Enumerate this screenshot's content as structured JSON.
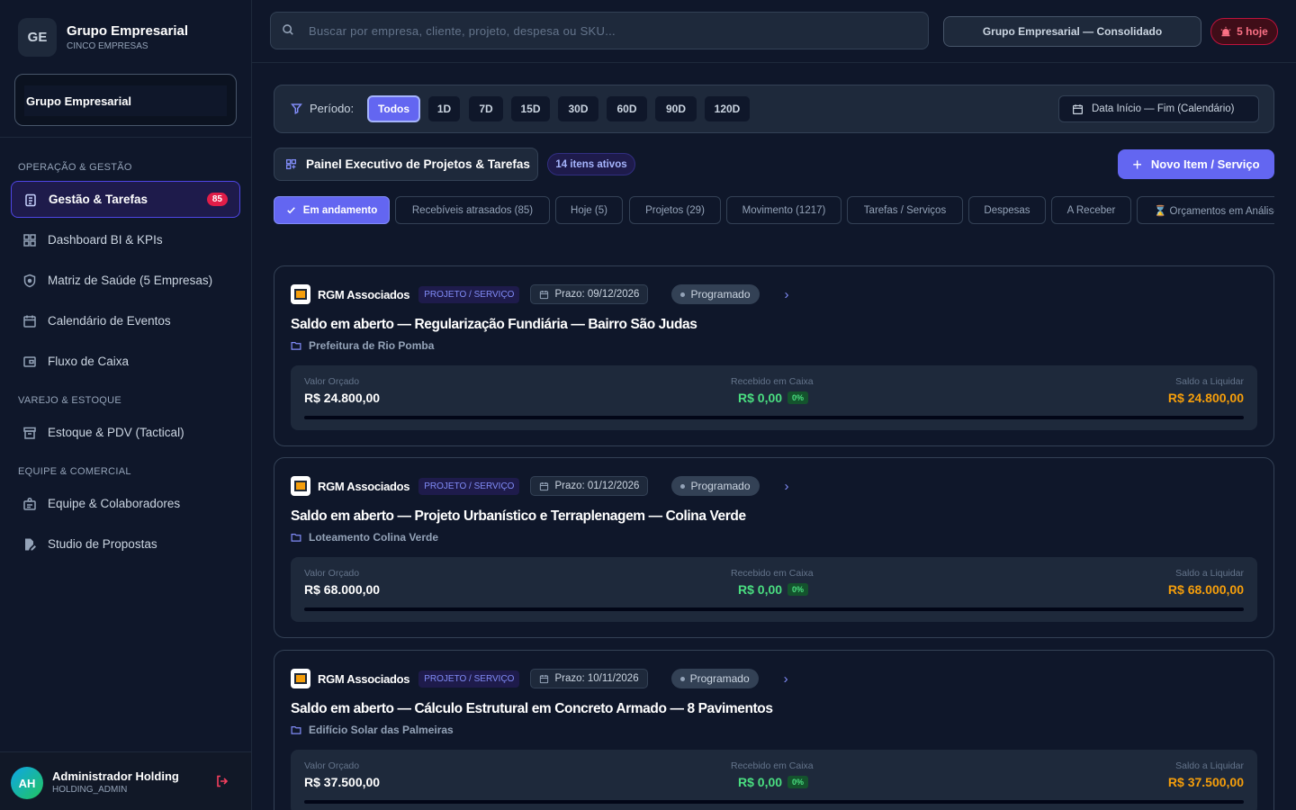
{
  "brand": {
    "initials": "GE",
    "title": "Grupo Empresarial",
    "subtitle": "CINCO EMPRESAS"
  },
  "company_selector": {
    "value": "Grupo Empresarial"
  },
  "sidebar": {
    "sections": [
      {
        "label": "OPERAÇÃO & GESTÃO"
      },
      {
        "label": "VAREJO & ESTOQUE"
      },
      {
        "label": "EQUIPE & COMERCIAL"
      }
    ],
    "items": [
      {
        "label": "Gestão & Tarefas",
        "icon": "clipboard-icon",
        "badge": "85"
      },
      {
        "label": "Dashboard BI & KPIs",
        "icon": "dashboard-icon"
      },
      {
        "label": "Matriz de Saúde (5 Empresas)",
        "icon": "shield-icon"
      },
      {
        "label": "Calendário de Eventos",
        "icon": "calendar-icon"
      },
      {
        "label": "Fluxo de Caixa",
        "icon": "wallet-icon"
      },
      {
        "label": "Estoque & PDV (Tactical)",
        "icon": "box-icon"
      },
      {
        "label": "Equipe & Colaboradores",
        "icon": "team-icon"
      },
      {
        "label": "Studio de Propostas",
        "icon": "file-edit-icon"
      }
    ]
  },
  "user": {
    "initials": "AH",
    "name": "Administrador Holding",
    "role": "HOLDING_ADMIN"
  },
  "topbar": {
    "search_placeholder": "Buscar por empresa, cliente, projeto, despesa ou SKU...",
    "scope": "Grupo Empresarial — Consolidado",
    "alerts": "5 hoje"
  },
  "filter": {
    "label": "Período:",
    "periods": [
      "Todos",
      "1D",
      "7D",
      "15D",
      "30D",
      "60D",
      "90D",
      "120D"
    ],
    "active_period": "Todos",
    "date_range": "Data Início — Fim (Calendário)"
  },
  "panel": {
    "title": "Painel Executivo de Projetos & Tarefas",
    "count": "14 itens ativos",
    "new_button": "Novo Item / Serviço"
  },
  "tabs": [
    "Em andamento",
    "Recebíveis atrasados (85)",
    "Hoje (5)",
    "Projetos (29)",
    "Movimento (1217)",
    "Tarefas / Serviços",
    "Despesas",
    "A Receber",
    "⌛ Orçamentos em Análise"
  ],
  "fin_labels": {
    "budget": "Valor Orçado",
    "received": "Recebido em Caixa",
    "balance": "Saldo a Liquidar"
  },
  "cards": [
    {
      "client": "RGM Associados",
      "type": "PROJETO / SERVIÇO",
      "due": "Prazo: 09/12/2026",
      "status": "Programado",
      "title": "Saldo em aberto — Regularização Fundiária — Bairro São Judas",
      "subtitle": "Prefeitura de Rio Pomba",
      "budget": "R$ 24.800,00",
      "received": "R$ 0,00",
      "pct": "0%",
      "balance": "R$ 24.800,00",
      "progress": 0
    },
    {
      "client": "RGM Associados",
      "type": "PROJETO / SERVIÇO",
      "due": "Prazo: 01/12/2026",
      "status": "Programado",
      "title": "Saldo em aberto — Projeto Urbanístico e Terraplenagem — Colina Verde",
      "subtitle": "Loteamento Colina Verde",
      "budget": "R$ 68.000,00",
      "received": "R$ 0,00",
      "pct": "0%",
      "balance": "R$ 68.000,00",
      "progress": 0
    },
    {
      "client": "RGM Associados",
      "type": "PROJETO / SERVIÇO",
      "due": "Prazo: 10/11/2026",
      "status": "Programado",
      "title": "Saldo em aberto — Cálculo Estrutural em Concreto Armado — 8 Pavimentos",
      "subtitle": "Edifício Solar das Palmeiras",
      "budget": "R$ 37.500,00",
      "received": "R$ 0,00",
      "pct": "0%",
      "balance": "R$ 37.500,00",
      "progress": 0
    }
  ],
  "colors": {
    "accent": "#6366f1",
    "positive": "#4ade80",
    "balance": "#f59e0b",
    "danger": "#e11d48"
  }
}
